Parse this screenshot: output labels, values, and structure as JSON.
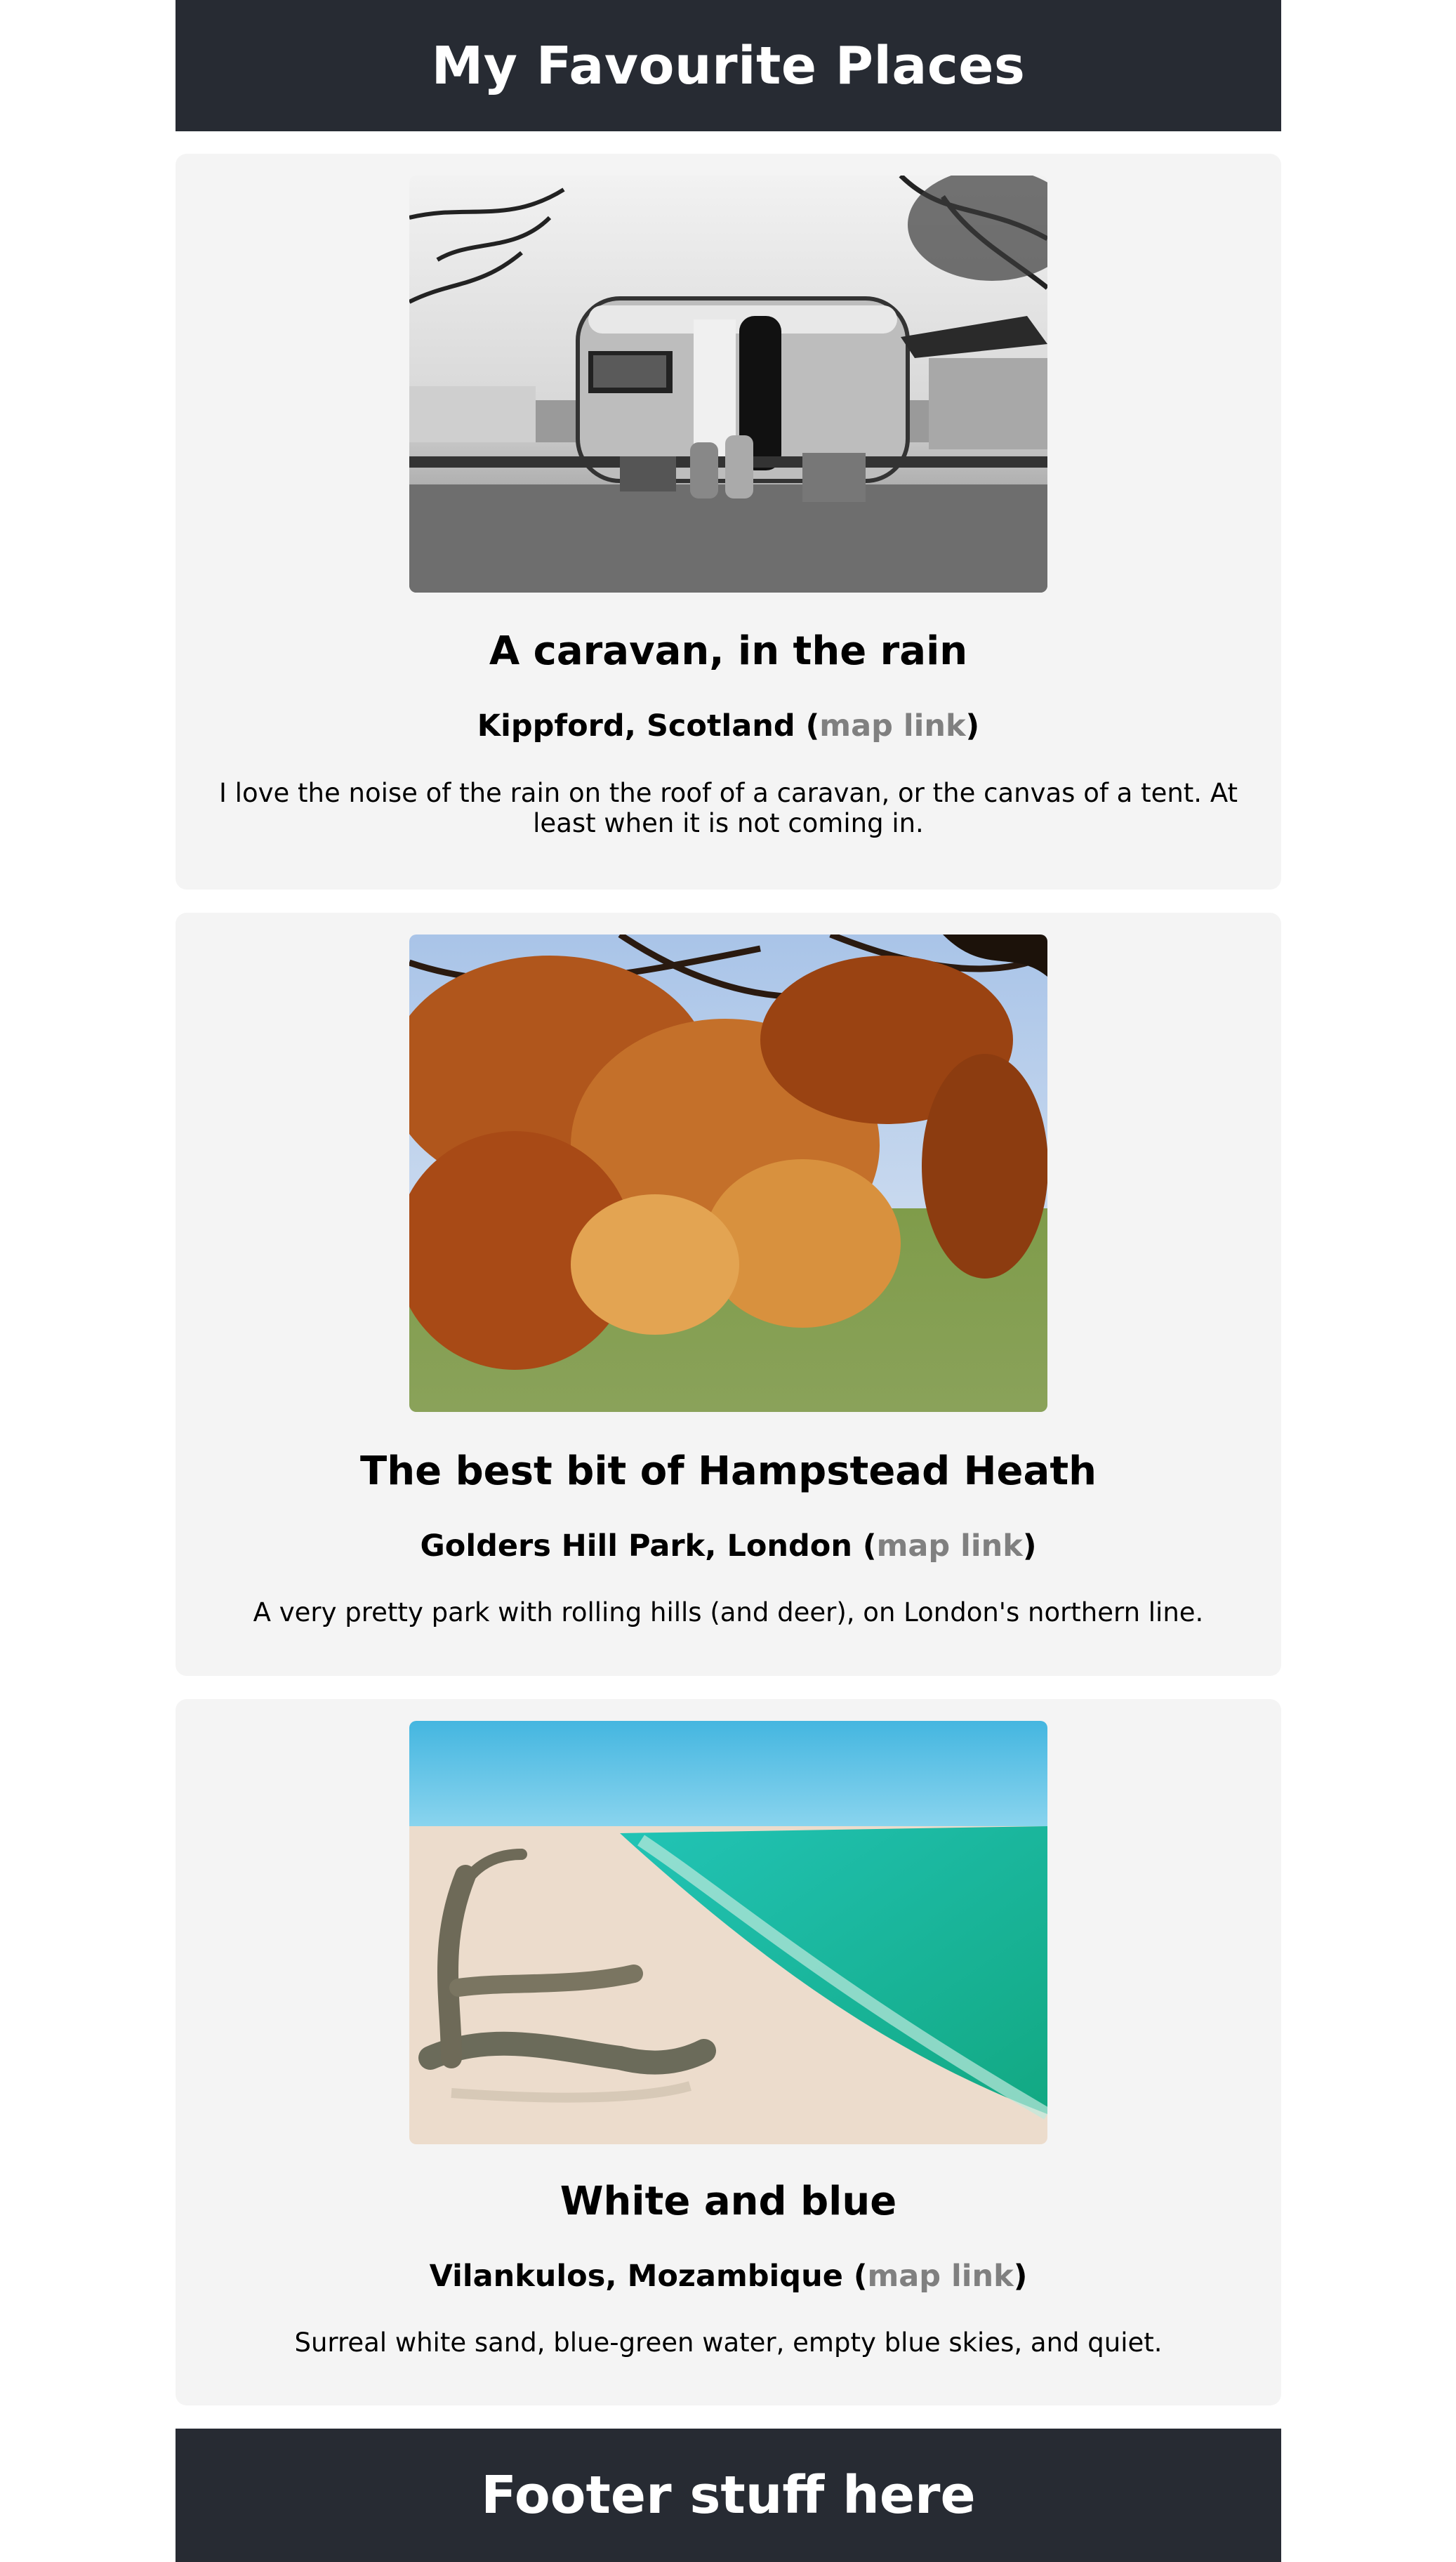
{
  "header": {
    "title": "My Favourite Places"
  },
  "places": [
    {
      "title": "A caravan, in the rain",
      "location": "Kippford, Scotland",
      "link_label": "map link",
      "description": "I love the noise of the rain on the roof of a caravan, or the canvas of a tent. At least when it is not coming in."
    },
    {
      "title": "The best bit of Hampstead Heath",
      "location": "Golders Hill Park, London",
      "link_label": "map link",
      "description": "A very pretty park with rolling hills (and deer), on London's northern line."
    },
    {
      "title": "White and blue",
      "location": "Vilankulos, Mozambique",
      "link_label": "map link",
      "description": "Surreal white sand, blue-green water, empty blue skies, and quiet."
    }
  ],
  "footer": {
    "text": "Footer stuff here"
  },
  "colors": {
    "header_bg": "#272b33",
    "card_bg": "#f4f4f4",
    "link": "#808080"
  }
}
